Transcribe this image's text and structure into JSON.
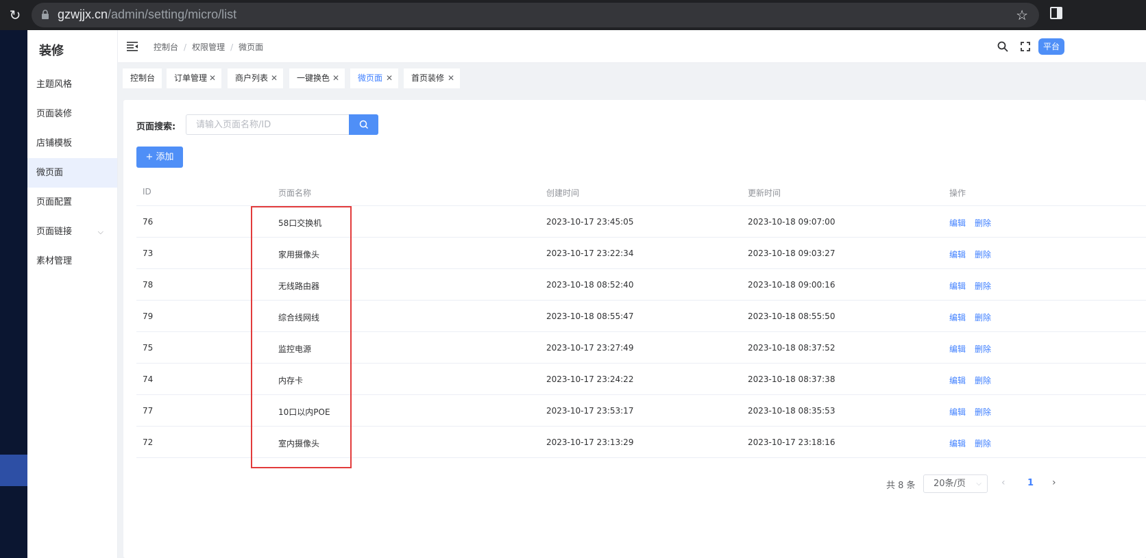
{
  "browser": {
    "url_host": "gzwjjx.cn",
    "url_path": "/admin/setting/micro/list"
  },
  "sidebar": {
    "title": "装修",
    "items": [
      {
        "label": "主题风格"
      },
      {
        "label": "页面装修"
      },
      {
        "label": "店铺模板"
      },
      {
        "label": "微页面",
        "active": true
      },
      {
        "label": "页面配置"
      },
      {
        "label": "页面链接",
        "has_children": true
      },
      {
        "label": "素材管理"
      }
    ]
  },
  "header": {
    "breadcrumb": [
      "控制台",
      "权限管理",
      "微页面"
    ],
    "platform_label": "平台"
  },
  "tabs": [
    {
      "label": "控制台"
    },
    {
      "label": "订单管理"
    },
    {
      "label": "商户列表"
    },
    {
      "label": "一键换色"
    },
    {
      "label": "微页面",
      "active": true
    },
    {
      "label": "首页装修"
    }
  ],
  "search": {
    "label": "页面搜索:",
    "placeholder": "请输入页面名称/ID",
    "value": ""
  },
  "add_button": "+ 添加",
  "table": {
    "columns": [
      "ID",
      "页面名称",
      "创建时间",
      "更新时间",
      "操作"
    ],
    "edit_label": "编辑",
    "delete_label": "删除",
    "rows": [
      {
        "id": "76",
        "name": "58口交换机",
        "created": "2023-10-17 23:45:05",
        "updated": "2023-10-18 09:07:00"
      },
      {
        "id": "73",
        "name": "家用摄像头",
        "created": "2023-10-17 23:22:34",
        "updated": "2023-10-18 09:03:27"
      },
      {
        "id": "78",
        "name": "无线路由器",
        "created": "2023-10-18 08:52:40",
        "updated": "2023-10-18 09:00:16"
      },
      {
        "id": "79",
        "name": "综合线网线",
        "created": "2023-10-18 08:55:47",
        "updated": "2023-10-18 08:55:50"
      },
      {
        "id": "75",
        "name": "监控电源",
        "created": "2023-10-17 23:27:49",
        "updated": "2023-10-18 08:37:52"
      },
      {
        "id": "74",
        "name": "内存卡",
        "created": "2023-10-17 23:24:22",
        "updated": "2023-10-18 08:37:38"
      },
      {
        "id": "77",
        "name": "10口以内POE",
        "created": "2023-10-17 23:53:17",
        "updated": "2023-10-18 08:35:53"
      },
      {
        "id": "72",
        "name": "室内摄像头",
        "created": "2023-10-17 23:13:29",
        "updated": "2023-10-17 23:18:16"
      }
    ]
  },
  "pagination": {
    "total": "共 8 条",
    "page_size": "20条/页",
    "current_page": "1"
  },
  "colors": {
    "primary": "#4f8ff7",
    "link": "#4080ff",
    "highlight_box": "#e23b3b",
    "dark_sidebar": "#0b1631"
  }
}
